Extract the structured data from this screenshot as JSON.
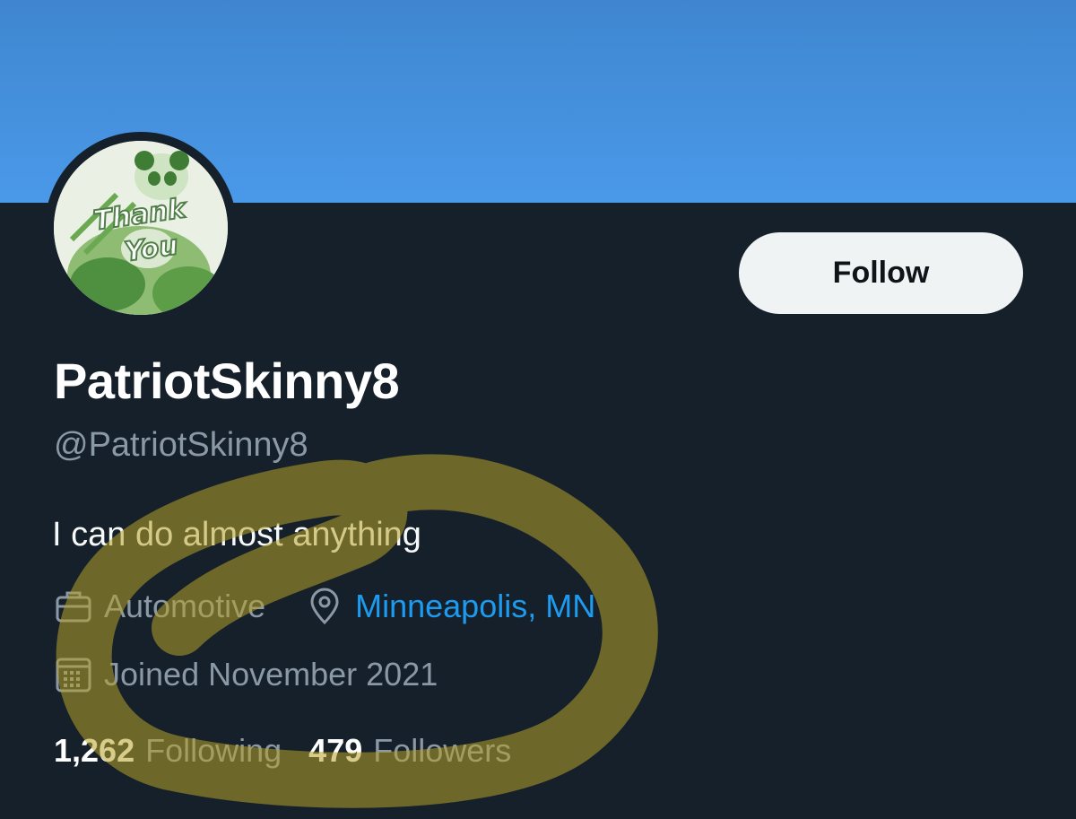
{
  "profile": {
    "display_name": "PatriotSkinny8",
    "handle": "@PatriotSkinny8",
    "bio": "I can do almost anything",
    "category": "Automotive",
    "location": "Minneapolis, MN",
    "joined": "Joined November 2021",
    "avatar_text": [
      "Thank",
      "You"
    ]
  },
  "actions": {
    "follow_label": "Follow"
  },
  "stats": {
    "following_count": "1,262",
    "following_label": "Following",
    "followers_count": "479",
    "followers_label": "Followers"
  },
  "icons": {
    "category": "briefcase-icon",
    "location": "location-pin-icon",
    "joined": "calendar-icon"
  },
  "colors": {
    "background": "#15202b",
    "banner": "#4a99e9",
    "link": "#1d9bf0",
    "secondary_text": "#8b98a5",
    "annotation": "#b8a32a"
  }
}
